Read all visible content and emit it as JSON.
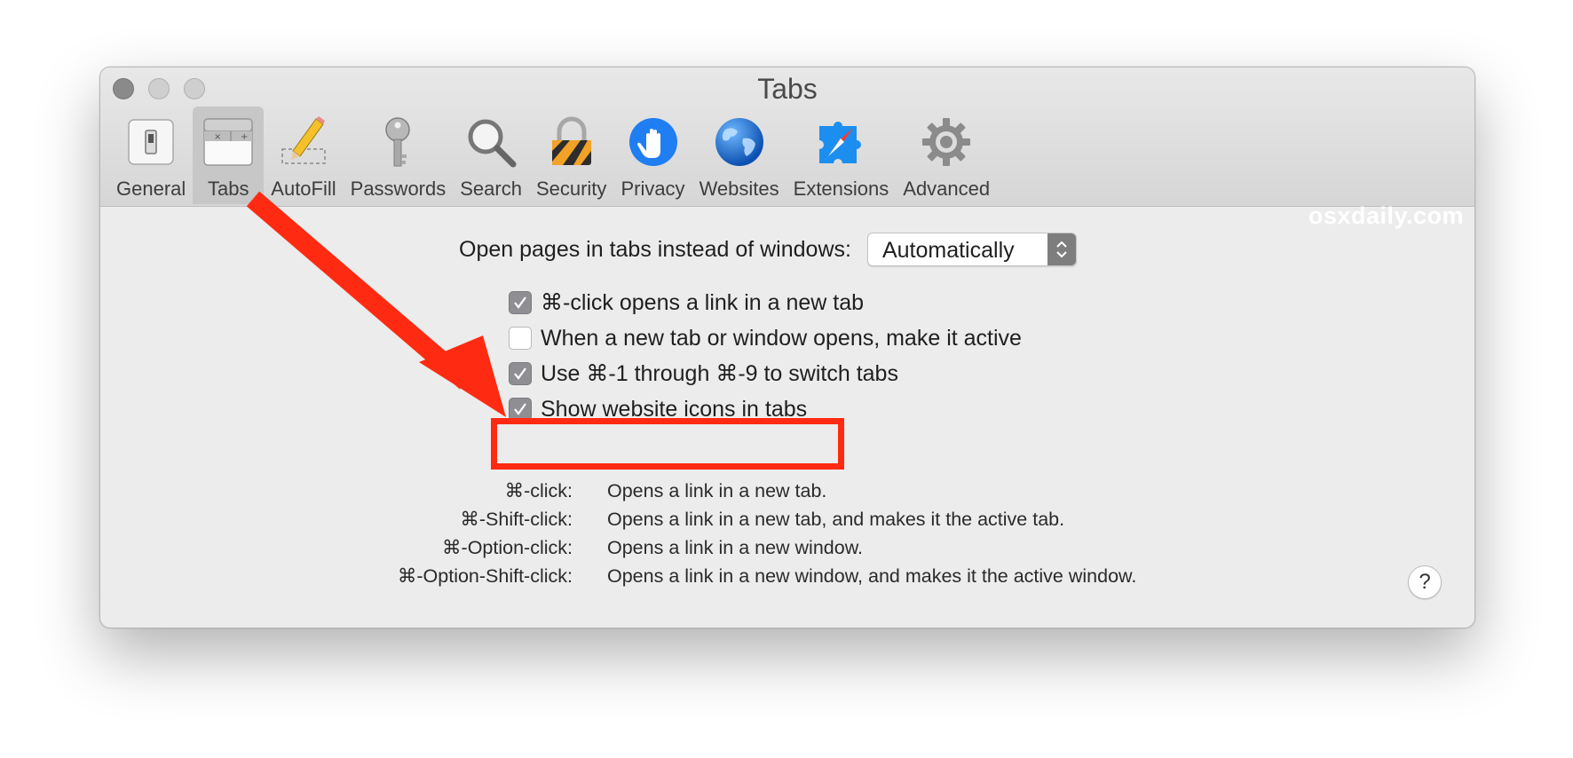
{
  "window": {
    "title": "Tabs"
  },
  "toolbar": {
    "items": [
      {
        "label": "General",
        "icon": "general-switch-icon"
      },
      {
        "label": "Tabs",
        "icon": "tabs-icon",
        "selected": true
      },
      {
        "label": "AutoFill",
        "icon": "pencil-icon"
      },
      {
        "label": "Passwords",
        "icon": "key-icon"
      },
      {
        "label": "Search",
        "icon": "magnifier-icon"
      },
      {
        "label": "Security",
        "icon": "padlock-icon"
      },
      {
        "label": "Privacy",
        "icon": "hand-icon"
      },
      {
        "label": "Websites",
        "icon": "globe-icon"
      },
      {
        "label": "Extensions",
        "icon": "compass-puzzle-icon"
      },
      {
        "label": "Advanced",
        "icon": "gear-icon"
      }
    ]
  },
  "watermark": "osxdaily.com",
  "open_pages": {
    "label": "Open pages in tabs instead of windows:",
    "selected": "Automatically"
  },
  "checkboxes": [
    {
      "label": "⌘-click opens a link in a new tab",
      "checked": true
    },
    {
      "label": "When a new tab or window opens, make it active",
      "checked": false
    },
    {
      "label": "Use ⌘-1 through ⌘-9 to switch tabs",
      "checked": true
    },
    {
      "label": "Show website icons in tabs",
      "checked": true
    }
  ],
  "shortcuts": [
    {
      "key": "⌘-click:",
      "desc": "Opens a link in a new tab."
    },
    {
      "key": "⌘-Shift-click:",
      "desc": "Opens a link in a new tab, and makes it the active tab."
    },
    {
      "key": "⌘-Option-click:",
      "desc": "Opens a link in a new window."
    },
    {
      "key": "⌘-Option-Shift-click:",
      "desc": "Opens a link in a new window, and makes it the active window."
    }
  ],
  "help_label": "?",
  "colors": {
    "annotation": "#ff2a12",
    "checkbox_on": "#8e8e93",
    "window_bg": "#ececec"
  }
}
